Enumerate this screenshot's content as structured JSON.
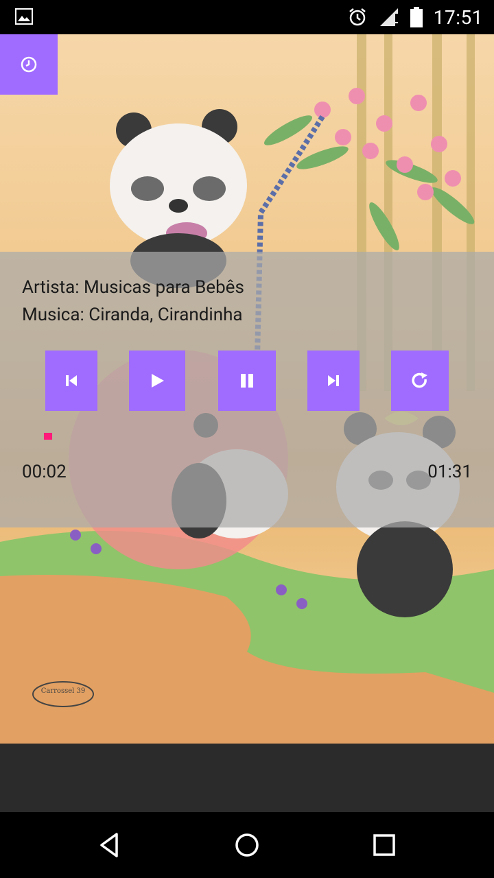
{
  "status_bar": {
    "time": "17:51",
    "icons": [
      "image-icon",
      "alarm-icon",
      "signal-icon",
      "battery-icon"
    ]
  },
  "alarm_button": {
    "icon": "alarm-clock-icon"
  },
  "player": {
    "artist_line": "Artista: Musicas para Bebês",
    "song_line": "Musica: Ciranda, Cirandinha",
    "controls": [
      {
        "name": "previous",
        "icon": "skip-previous-icon"
      },
      {
        "name": "play",
        "icon": "play-icon"
      },
      {
        "name": "pause",
        "icon": "pause-icon"
      },
      {
        "name": "next",
        "icon": "skip-next-icon"
      },
      {
        "name": "repeat",
        "icon": "repeat-icon"
      }
    ],
    "elapsed": "00:02",
    "duration": "01:31",
    "progress_fraction": 0.022
  },
  "artwork": {
    "caption": "Carrossel 39"
  },
  "colors": {
    "accent": "#a06bff",
    "seek": "#ff1a7a",
    "overlay": "#aaaaaa"
  },
  "nav_bar": {
    "buttons": [
      "back-icon",
      "home-icon",
      "recents-icon"
    ]
  }
}
